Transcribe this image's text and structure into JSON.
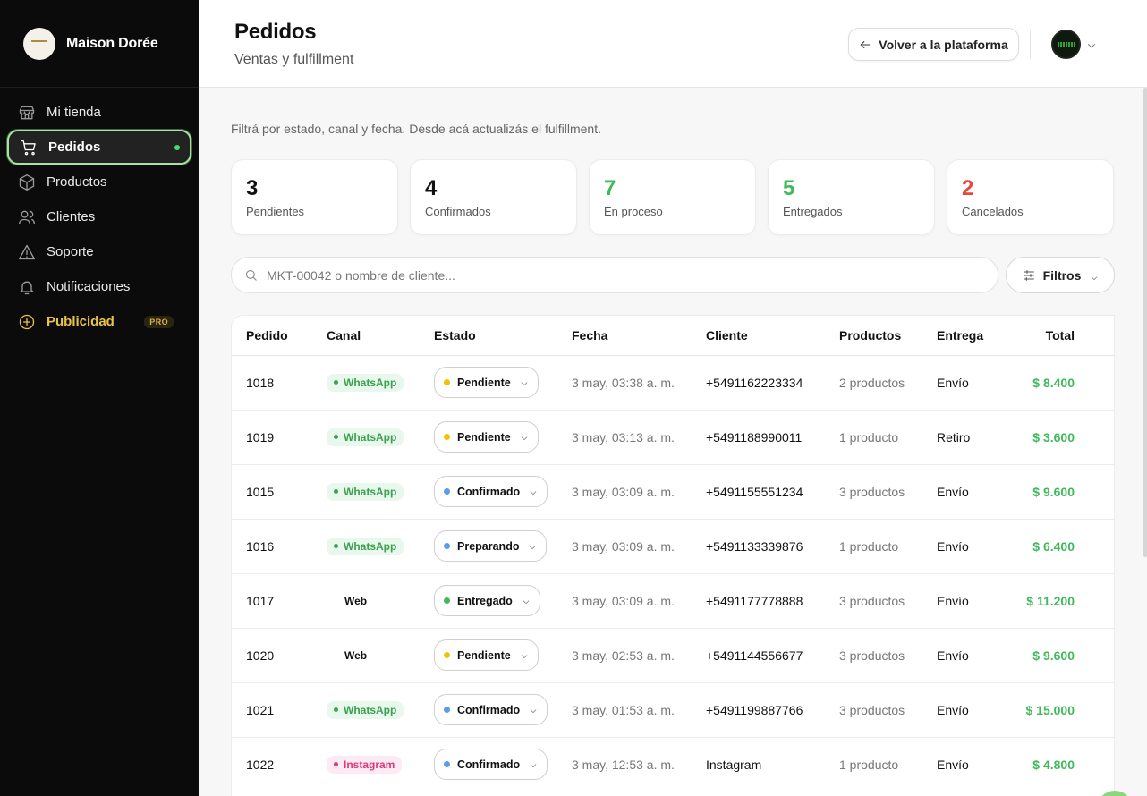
{
  "sidebar": {
    "brand": "Maison Dorée",
    "items": [
      {
        "label": "Mi tienda",
        "icon": "store-icon"
      },
      {
        "label": "Pedidos",
        "icon": "cart-icon"
      },
      {
        "label": "Productos",
        "icon": "box-icon"
      },
      {
        "label": "Clientes",
        "icon": "users-icon"
      },
      {
        "label": "Soporte",
        "icon": "alert-icon"
      },
      {
        "label": "Notificaciones",
        "icon": "bell-icon"
      },
      {
        "label": "Publicidad",
        "icon": "plus-circle-icon",
        "badge": "PRO"
      }
    ],
    "active_index": 1
  },
  "header": {
    "title": "Pedidos",
    "subtitle": "Ventas y fulfillment",
    "back_label": "Volver a la plataforma"
  },
  "main": {
    "intro": "Filtrá por estado, canal y fecha. Desde acá actualizás el fulfillment.",
    "stats": [
      {
        "value": "3",
        "label": "Pendientes",
        "color": "#111111"
      },
      {
        "value": "4",
        "label": "Confirmados",
        "color": "#111111"
      },
      {
        "value": "7",
        "label": "En proceso",
        "color": "#3fba5a"
      },
      {
        "value": "5",
        "label": "Entregados",
        "color": "#3fba5a"
      },
      {
        "value": "2",
        "label": "Cancelados",
        "color": "#e5483b"
      }
    ],
    "search_placeholder": "MKT-00042 o nombre de cliente...",
    "filter_label": "Filtros"
  },
  "table": {
    "columns": [
      "Pedido",
      "Canal",
      "Estado",
      "Fecha",
      "Cliente",
      "Productos",
      "Entrega",
      "Total"
    ],
    "rows": [
      {
        "order": "1018",
        "channel": "WhatsApp",
        "channel_type": "whatsapp",
        "status": "Pendiente",
        "status_color": "#f2c300",
        "date": "3 may, 03:38 a. m.",
        "client": "+5491162223334",
        "products": "2 productos",
        "delivery": "Envío",
        "total": "$ 8.400"
      },
      {
        "order": "1019",
        "channel": "WhatsApp",
        "channel_type": "whatsapp",
        "status": "Pendiente",
        "status_color": "#f2c300",
        "date": "3 may, 03:13 a. m.",
        "client": "+5491188990011",
        "products": "1 producto",
        "delivery": "Retiro",
        "total": "$ 3.600"
      },
      {
        "order": "1015",
        "channel": "WhatsApp",
        "channel_type": "whatsapp",
        "status": "Confirmado",
        "status_color": "#5b9be8",
        "date": "3 may, 03:09 a. m.",
        "client": "+5491155551234",
        "products": "3 productos",
        "delivery": "Envío",
        "total": "$ 9.600"
      },
      {
        "order": "1016",
        "channel": "WhatsApp",
        "channel_type": "whatsapp",
        "status": "Preparando",
        "status_color": "#5b9be8",
        "date": "3 may, 03:09 a. m.",
        "client": "+5491133339876",
        "products": "1 producto",
        "delivery": "Envío",
        "total": "$ 6.400"
      },
      {
        "order": "1017",
        "channel": "Web",
        "channel_type": "web",
        "status": "Entregado",
        "status_color": "#3fba5a",
        "date": "3 may, 03:09 a. m.",
        "client": "+5491177778888",
        "products": "3 productos",
        "delivery": "Envío",
        "total": "$ 11.200"
      },
      {
        "order": "1020",
        "channel": "Web",
        "channel_type": "web",
        "status": "Pendiente",
        "status_color": "#f2c300",
        "date": "3 may, 02:53 a. m.",
        "client": "+5491144556677",
        "products": "3 productos",
        "delivery": "Envío",
        "total": "$ 9.600"
      },
      {
        "order": "1021",
        "channel": "WhatsApp",
        "channel_type": "whatsapp",
        "status": "Confirmado",
        "status_color": "#5b9be8",
        "date": "3 may, 01:53 a. m.",
        "client": "+5491199887766",
        "products": "3 productos",
        "delivery": "Envío",
        "total": "$ 15.000"
      },
      {
        "order": "1022",
        "channel": "Instagram",
        "channel_type": "instagram",
        "status": "Confirmado",
        "status_color": "#5b9be8",
        "date": "3 may, 12:53 a. m.",
        "client": "Instagram",
        "products": "1 producto",
        "delivery": "Envío",
        "total": "$ 4.800"
      }
    ]
  }
}
